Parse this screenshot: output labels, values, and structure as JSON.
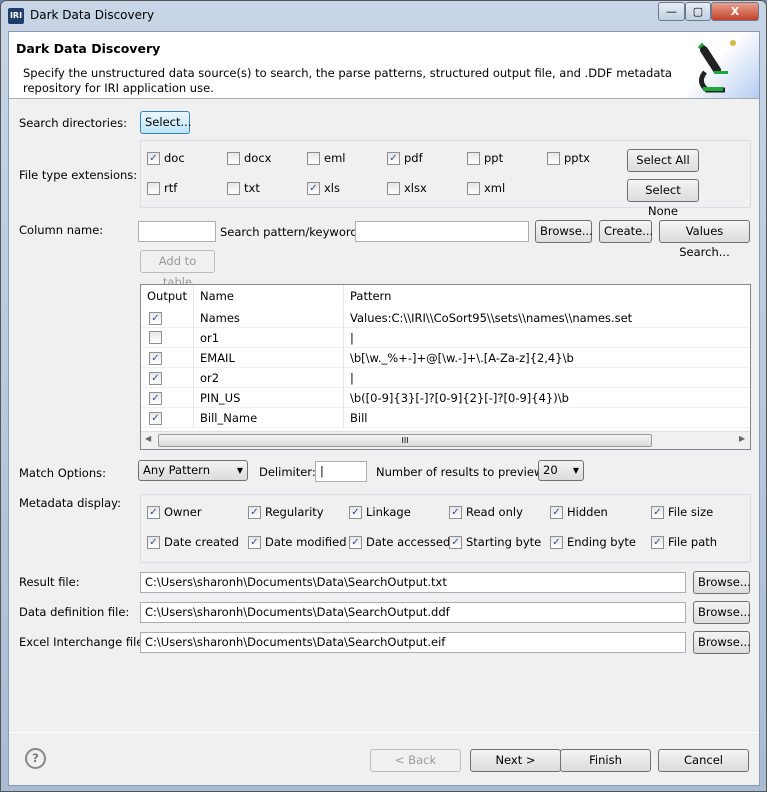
{
  "window": {
    "title": "Dark Data Discovery",
    "app_icon": "IRI",
    "controls": {
      "minimize": "—",
      "maximize": "▢",
      "close": "X"
    }
  },
  "header": {
    "title": "Dark Data Discovery",
    "description": "Specify the unstructured data source(s) to search, the parse patterns, structured output file, and .DDF metadata repository for IRI application use.",
    "icon": "microscope-icon"
  },
  "search_directories": {
    "label": "Search directories:",
    "button": "Select..."
  },
  "file_types": {
    "label": "File type extensions:",
    "items": [
      {
        "label": "doc",
        "checked": true
      },
      {
        "label": "docx",
        "checked": false
      },
      {
        "label": "eml",
        "checked": false
      },
      {
        "label": "pdf",
        "checked": true
      },
      {
        "label": "ppt",
        "checked": false
      },
      {
        "label": "pptx",
        "checked": false
      },
      {
        "label": "rtf",
        "checked": false
      },
      {
        "label": "txt",
        "checked": false
      },
      {
        "label": "xls",
        "checked": true
      },
      {
        "label": "xlsx",
        "checked": false
      },
      {
        "label": "xml",
        "checked": false
      }
    ],
    "select_all": "Select All",
    "select_none": "Select None"
  },
  "column": {
    "label": "Column name:",
    "value": "",
    "pattern_label": "Search pattern/keyword:",
    "pattern_value": "",
    "browse": "Browse...",
    "create": "Create...",
    "values_search": "Values Search...",
    "add_to_table": "Add to table"
  },
  "table": {
    "headers": [
      "Output",
      "Name",
      "Pattern"
    ],
    "rows": [
      {
        "checked": true,
        "name": "Names",
        "pattern": "Values:C:\\\\IRI\\\\CoSort95\\\\sets\\\\names\\\\names.set"
      },
      {
        "checked": false,
        "name": "or1",
        "pattern": "|"
      },
      {
        "checked": true,
        "name": "EMAIL",
        "pattern": "\\b[\\w._%+-]+@[\\w.-]+\\.[A-Za-z]{2,4}\\b"
      },
      {
        "checked": true,
        "name": "or2",
        "pattern": "|"
      },
      {
        "checked": true,
        "name": "PIN_US",
        "pattern": "\\b([0-9]{3}[-]?[0-9]{2}[-]?[0-9]{4})\\b"
      },
      {
        "checked": true,
        "name": "Bill_Name",
        "pattern": "Bill"
      }
    ],
    "scroll_grip": "III"
  },
  "match": {
    "label": "Match Options:",
    "value": "Any Pattern",
    "delimiter_label": "Delimiter:",
    "delimiter_value": "|",
    "results_label": "Number of results to preview:",
    "results_value": "20"
  },
  "metadata": {
    "label": "Metadata display:",
    "items": [
      {
        "label": "Owner",
        "checked": true
      },
      {
        "label": "Regularity",
        "checked": true
      },
      {
        "label": "Linkage",
        "checked": true
      },
      {
        "label": "Read only",
        "checked": true
      },
      {
        "label": "Hidden",
        "checked": true
      },
      {
        "label": "File size",
        "checked": true
      },
      {
        "label": "Date created",
        "checked": true
      },
      {
        "label": "Date modified",
        "checked": true
      },
      {
        "label": "Date accessed",
        "checked": true
      },
      {
        "label": "Starting byte",
        "checked": true
      },
      {
        "label": "Ending byte",
        "checked": true
      },
      {
        "label": "File path",
        "checked": true
      }
    ]
  },
  "files": [
    {
      "label": "Result file:",
      "value": "C:\\Users\\sharonh\\Documents\\Data\\SearchOutput.txt",
      "button": "Browse..."
    },
    {
      "label": "Data definition file:",
      "value": "C:\\Users\\sharonh\\Documents\\Data\\SearchOutput.ddf",
      "button": "Browse..."
    },
    {
      "label": "Excel Interchange file:",
      "value": "C:\\Users\\sharonh\\Documents\\Data\\SearchOutput.eif",
      "button": "Browse..."
    }
  ],
  "footer": {
    "help": "?",
    "back": "< Back",
    "next": "Next >",
    "finish": "Finish",
    "cancel": "Cancel"
  }
}
